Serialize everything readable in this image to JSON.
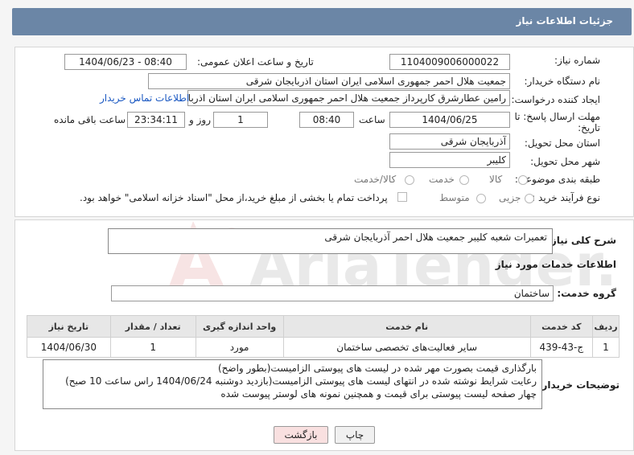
{
  "header": {
    "title": "جزئیات اطلاعات نیاز"
  },
  "form": {
    "need_number_label": "شماره نیاز:",
    "need_number": "1104009006000022",
    "announce_label": "تاریخ و ساعت اعلان عمومی:",
    "announce_value": "1404/06/23 - 08:40",
    "buyer_org_label": "نام دستگاه خریدار:",
    "buyer_org": "جمعیت هلال احمر جمهوری اسلامی ایران استان اذربایجان شرقی",
    "creator_label": "ایجاد کننده درخواست:",
    "creator": "رامین عطارشرق کارپرداز جمعیت هلال احمر جمهوری اسلامی ایران استان اذربایجان شرقی",
    "contact_link": "اطلاعات تماس خریدار",
    "deadline_label_1": "مهلت ارسال پاسخ: تا",
    "deadline_label_2": "تاریخ:",
    "deadline_date": "1404/06/25",
    "time_label": "ساعت",
    "deadline_time": "08:40",
    "days_value": "1",
    "days_label": "روز و",
    "remaining_time": "23:34:11",
    "remaining_label": "ساعت باقی مانده",
    "province_label": "استان محل تحویل:",
    "province": "آذربایجان شرقی",
    "city_label": "شهر محل تحویل:",
    "city": "کلیبر",
    "category_label": "طبقه بندی موضوعی:",
    "category_options": [
      "کالا",
      "خدمت",
      "کالا/خدمت"
    ],
    "process_label": "نوع فرآیند خرید :",
    "process_options": [
      "جزیی",
      "متوسط"
    ],
    "payment_note": "پرداخت تمام یا بخشی از مبلغ خرید،از محل \"اسناد خزانه اسلامی\" خواهد بود."
  },
  "summary": {
    "label": "شرح کلی نیاز:",
    "value": "تعمیرات شعبه کلیبر جمعیت هلال احمر آذربایجان شرقی"
  },
  "services": {
    "section_title": "اطلاعات خدمات مورد نیاز",
    "group_label": "گروه خدمت:",
    "group_value": "ساختمان",
    "columns": [
      "ردیف",
      "کد خدمت",
      "نام خدمت",
      "واحد اندازه گیری",
      "تعداد / مقدار",
      "تاریخ نیاز"
    ],
    "rows": [
      {
        "row": "1",
        "code": "ج-43-439",
        "name": "سایر فعالیت‌های تخصصی ساختمان",
        "unit": "مورد",
        "qty": "1",
        "date": "1404/06/30"
      }
    ]
  },
  "buyer_notes": {
    "label": "توضیحات خریدار:",
    "lines": [
      "بارگذاری قیمت بصورت مهر شده در لیست های پیوستی الزامیست(بطور واضح)",
      "رعایت شرایط نوشته شده در انتهای لیست های پیوستی الزامیست(بازدید دوشنبه 1404/06/24 راس ساعت 10 صبح)",
      "چهار صفحه لیست پیوستی برای قیمت و همچنین نمونه های لوستر پیوست شده"
    ]
  },
  "buttons": {
    "print": "چاپ",
    "back": "بازگشت"
  },
  "watermark": {
    "text": "AriaTender.neT"
  },
  "colors": {
    "header": "#6b86a6",
    "link": "#1a58c2",
    "back_button": "#f9e0e0"
  }
}
